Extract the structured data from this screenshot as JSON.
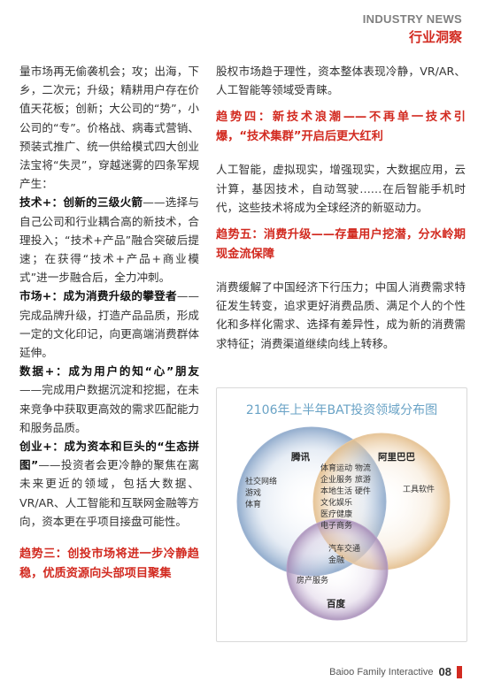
{
  "header": {
    "en": "INDUSTRY NEWS",
    "zh": "行业洞察"
  },
  "left": {
    "intro": "量市场再无偷袭机会；攻；出海，下乡，二次元；升级；精耕用户存在价值天花板；创新；大公司的“势”，小公司的“专”。价格战、病毒式营销、预装式推广、统一供给模式四大创业法宝将“失灵”，穿越迷雾的四条军规产生：",
    "items": [
      {
        "head": "技术+：创新的三级火箭",
        "body": "——选择与自己公司和行业耦合高的新技术，合理投入；“技术+产品”融合突破后提速；在获得“技术+产品+商业模式”进一步融合后，全力冲刺。"
      },
      {
        "head": "市场+：成为消费升级的攀登者",
        "body": "——完成品牌升级，打造产品品质，形成一定的文化印记，向更高端消费群体延伸。"
      },
      {
        "head": "数据+：成为用户的知“心”朋友",
        "body": "——完成用户数据沉淀和挖掘，在未来竞争中获取更高效的需求匹配能力和服务品质。"
      },
      {
        "head": "创业+：成为资本和巨头的“生态拼图”",
        "body": "——投资者会更冷静的聚焦在离未来更近的领域，包括大数据、VR/AR、人工智能和互联网金融等方向，资本更在乎项目接盘可能性。"
      }
    ],
    "trend3": "趋势三：创投市场将进一步冷静趋稳，优质资源向头部项目聚集"
  },
  "right": {
    "intro": "股权市场趋于理性，资本整体表现冷静，VR/AR、人工智能等领域受青睐。",
    "trend4": "趋势四：新技术浪潮——不再单一技术引爆，“技术集群”开启后更大红利",
    "p4": "人工智能，虚拟现实，增强现实，大数据应用，云计算，基因技术，自动驾驶……在后智能手机时代，这些技术将成为全球经济的新驱动力。",
    "trend5": "趋势五：消费升级——存量用户挖潜，分水岭期现金流保障",
    "p5": "消费缓解了中国经济下行压力；中国人消费需求特征发生转变，追求更好消费品质、满足个人的个性化和多样化需求、选择有差异性，成为新的消费需求特征；消费渠道继续向线上转移。"
  },
  "figure": {
    "title": "2106年上半年BAT投资领域分布图",
    "sets": {
      "tencent": "腾讯",
      "alibaba": "阿里巴巴",
      "baidu": "百度"
    },
    "tencent_only": [
      "社交网络",
      "游戏",
      "体育"
    ],
    "alibaba_only": [
      "工具软件"
    ],
    "tencent_alibaba": [
      "体育运动 物流",
      "企业服务 旅游",
      "本地生活 硬件",
      "文化娱乐",
      "医疗健康",
      "电子商务"
    ],
    "all_three": [
      "汽车交通",
      "金融"
    ],
    "tencent_baidu": [
      "房产服务"
    ],
    "colors": {
      "tencent": "#7f9ec4",
      "alibaba": "#e3bd8a",
      "baidu": "#a58bb6"
    }
  },
  "footer": {
    "brand": "Baioo Family Interactive",
    "page": "08"
  }
}
